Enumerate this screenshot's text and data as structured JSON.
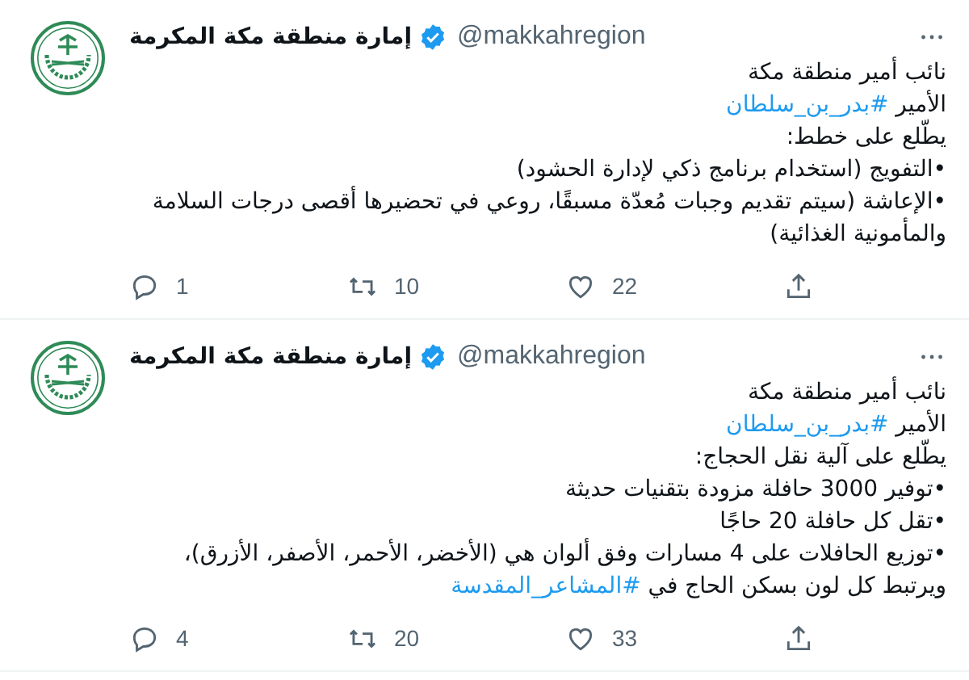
{
  "tweets": [
    {
      "author": {
        "name": "إمارة منطقة مكة المكرمة",
        "verified": true,
        "handle": "@makkahregion"
      },
      "lines": [
        [
          {
            "kind": "text",
            "text": "نائب أمير منطقة مكة"
          }
        ],
        [
          {
            "kind": "text",
            "text": "الأمير "
          },
          {
            "kind": "hashtag",
            "text": "#بدر_بن_سلطان"
          }
        ],
        [
          {
            "kind": "text",
            "text": "يطّلع على خطط:"
          }
        ],
        [
          {
            "kind": "text",
            "text": "•التفويج (استخدام برنامج ذكي لإدارة الحشود)"
          }
        ],
        [
          {
            "kind": "text",
            "text": "•الإعاشة (سيتم تقديم وجبات مُعدّة مسبقًا، روعي في تحضيرها أقصى درجات السلامة والمأمونية الغذائية)"
          }
        ]
      ],
      "stats": {
        "replies": "1",
        "retweets": "10",
        "likes": "22"
      }
    },
    {
      "author": {
        "name": "إمارة منطقة مكة المكرمة",
        "verified": true,
        "handle": "@makkahregion"
      },
      "lines": [
        [
          {
            "kind": "text",
            "text": "نائب أمير منطقة مكة"
          }
        ],
        [
          {
            "kind": "text",
            "text": "الأمير "
          },
          {
            "kind": "hashtag",
            "text": "#بدر_بن_سلطان"
          }
        ],
        [
          {
            "kind": "text",
            "text": "يطّلع على آلية نقل الحجاج:"
          }
        ],
        [
          {
            "kind": "text",
            "text": "•توفير 3000 حافلة مزودة بتقنيات حديثة"
          }
        ],
        [
          {
            "kind": "text",
            "text": "•تقل كل حافلة 20 حاجًا"
          }
        ],
        [
          {
            "kind": "text",
            "text": "•توزيع الحافلات على 4 مسارات وفق ألوان هي (الأخضر، الأحمر، الأصفر، الأزرق)،"
          }
        ],
        [
          {
            "kind": "text",
            "text": "ويرتبط كل لون بسكن الحاج في "
          },
          {
            "kind": "hashtag",
            "text": "#المشاعر_المقدسة"
          }
        ]
      ],
      "stats": {
        "replies": "4",
        "retweets": "20",
        "likes": "33"
      }
    }
  ]
}
